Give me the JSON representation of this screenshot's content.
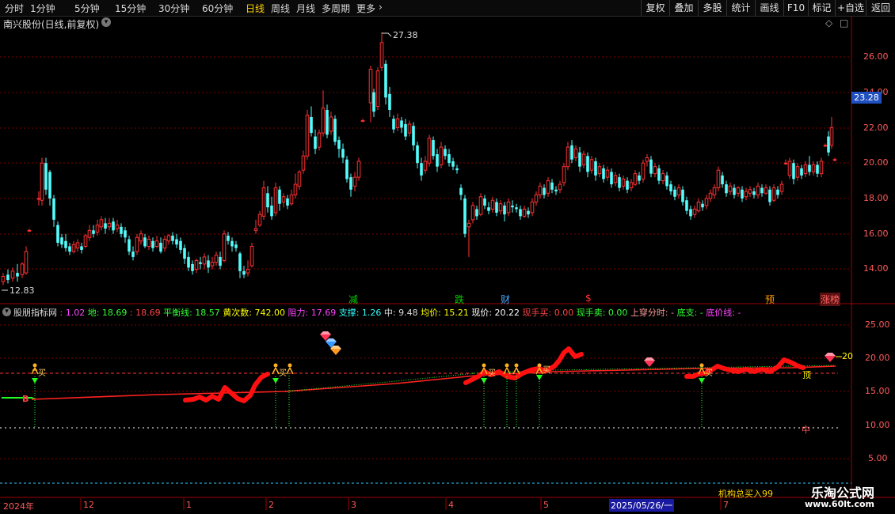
{
  "toolbar": {
    "periods": [
      "分时",
      "1分钟",
      "5分钟",
      "15分钟",
      "30分钟",
      "60分钟",
      "日线",
      "周线",
      "月线",
      "多周期",
      "更多"
    ],
    "active_period": "日线",
    "more_arrow": "›",
    "right_buttons": [
      "复权",
      "叠加",
      "多股",
      "统计",
      "画线",
      "F10",
      "标记",
      "+自选",
      "返回"
    ]
  },
  "chart_title": {
    "text": "南兴股份(日线,前复权)",
    "dropdown_icon": "chevron-down-icon"
  },
  "top_right_icons": {
    "diamond": "◇",
    "square": "□"
  },
  "price_axis": {
    "ticks": [
      "26.00",
      "24.00",
      "22.00",
      "20.00",
      "18.00",
      "16.00",
      "14.00"
    ],
    "current_price": "23.28"
  },
  "price_annotations": {
    "high": "27.38",
    "low": "12.83"
  },
  "event_markers": [
    {
      "text": "减",
      "color": "#00d000"
    },
    {
      "text": "跌",
      "color": "#00d000"
    },
    {
      "text": "财",
      "color": "#4aa8ff"
    },
    {
      "text": "$",
      "color": "#ff3333"
    },
    {
      "text": "预",
      "color": "#ff9a00"
    },
    {
      "text": "涨榜",
      "color": "#ff6666"
    }
  ],
  "indicator": {
    "name": "股朋指标网",
    "items": [
      {
        "text": ": 1.02",
        "color": "#ff44ff"
      },
      {
        "text": "地: 18.69",
        "color": "#33ff33"
      },
      {
        "text": ": 18.69",
        "color": "#ff4444"
      },
      {
        "text": "平衡线: 18.57",
        "color": "#33ff33"
      },
      {
        "text": "黄次数: 742.00",
        "color": "#ffff00"
      },
      {
        "text": "阻力: 17.69",
        "color": "#ff44ff"
      },
      {
        "text": "支撑: 1.26",
        "color": "#33ffff"
      },
      {
        "text": "中: 9.48",
        "color": "#dddddd"
      },
      {
        "text": "均价: 15.21",
        "color": "#ffff00"
      },
      {
        "text": "现价: 20.22",
        "color": "#ffffff"
      },
      {
        "text": "现手买: 0.00",
        "color": "#ff4444"
      },
      {
        "text": "现手卖: 0.00",
        "color": "#33ff33"
      },
      {
        "text": "上穿分时: -",
        "color": "#ff9999"
      },
      {
        "text": "底支: -",
        "color": "#33ff33"
      },
      {
        "text": "底价线: -",
        "color": "#ff44ff"
      }
    ]
  },
  "lower_axis": {
    "ticks": [
      "25.00",
      "20.00",
      "15.00",
      "10.00",
      "5.00"
    ]
  },
  "lower_labels": {
    "top_right_value": "20",
    "ding": "顶",
    "zhong": "中",
    "b_mark": "B",
    "buy_mark": "买"
  },
  "institution_text": "机构总买入99",
  "time_axis": {
    "labels": [
      "2024年",
      "12",
      "1",
      "2",
      "3",
      "4",
      "5",
      "2025/05/26/一",
      "7"
    ]
  },
  "watermark": {
    "line1": "乐淘公式网",
    "line2": "www.60lt.com"
  },
  "colors": {
    "up": "#ff3232",
    "down": "#54fcfc",
    "grid": "#8b0000",
    "axis": "#a00000"
  }
}
